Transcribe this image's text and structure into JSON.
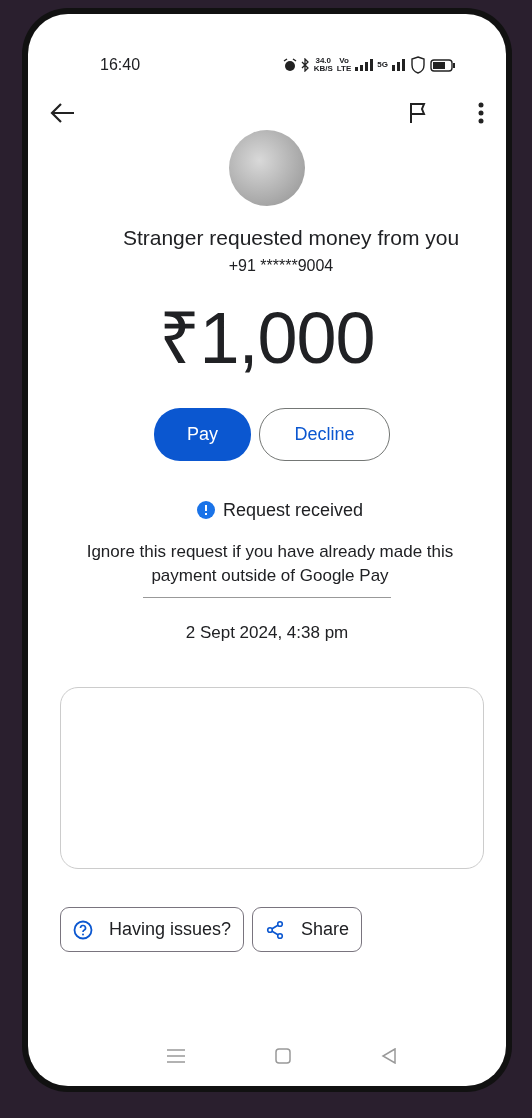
{
  "status_bar": {
    "time": "16:40",
    "speed_value": "34.0",
    "speed_unit": "KB/S",
    "volte_top": "Vo",
    "volte_bottom": "LTE",
    "network": "5G"
  },
  "request": {
    "requester": "Stranger",
    "message": "requested money from you",
    "phone": "+91 ******9004",
    "amount": "₹1,000"
  },
  "buttons": [
    {
      "label": "Pay",
      "kind": "primary"
    },
    {
      "label": "Decline",
      "kind": "outline"
    }
  ],
  "status": {
    "label": "Request received"
  },
  "note": "Ignore this request if you have already made this payment outside of Google Pay",
  "date": "2 Sept 2024, 4:38 pm",
  "actions": [
    {
      "label": "Having issues?",
      "kind": "help"
    },
    {
      "label": "Share",
      "kind": "share"
    }
  ]
}
